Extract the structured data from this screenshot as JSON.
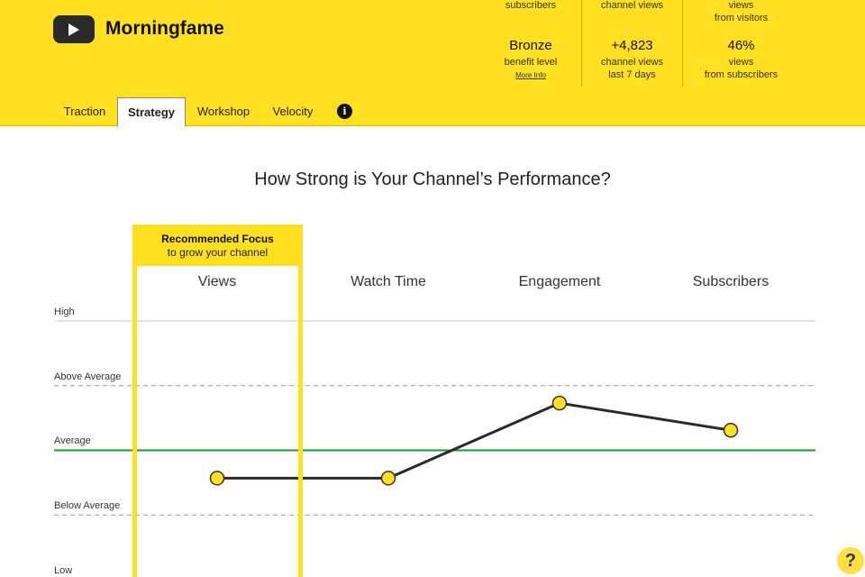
{
  "header": {
    "brand": "Morningfame",
    "logo_icon": "play-icon",
    "stats": [
      {
        "top": "subscribers",
        "value": "Bronze",
        "label": "benefit level",
        "link": "More Info"
      },
      {
        "top": "channel views",
        "value": "+4,823",
        "label_line1": "channel views",
        "label_line2": "last 7 days"
      },
      {
        "top_line1": "views",
        "top_line2": "from visitors",
        "value": "46%",
        "label_line1": "views",
        "label_line2": "from subscribers"
      }
    ]
  },
  "tabs": [
    {
      "label": "Traction",
      "active": false
    },
    {
      "label": "Strategy",
      "active": true
    },
    {
      "label": "Workshop",
      "active": false
    },
    {
      "label": "Velocity",
      "active": false
    }
  ],
  "info_icon": "i",
  "focus": {
    "title": "Recommended Focus",
    "subtitle": "to grow your channel"
  },
  "help_icon": "?",
  "colors": {
    "brand_yellow": "#ffe020",
    "average_line": "#1a9a2a",
    "point_fill": "#ffdf20",
    "line": "#2a2a2a"
  },
  "chart_data": {
    "type": "line",
    "title": "How Strong is Your Channel’s Performance?",
    "categories": [
      "Views",
      "Watch Time",
      "Engagement",
      "Subscribers"
    ],
    "levels": [
      "Low",
      "Below Average",
      "Average",
      "Above Average",
      "High"
    ],
    "ylim": [
      0,
      4
    ],
    "values": [
      1.57,
      1.57,
      2.73,
      2.31
    ],
    "highlighted_category": "Views",
    "reference_line": {
      "label": "Average",
      "value": 2
    },
    "xlabel": "",
    "ylabel": ""
  }
}
